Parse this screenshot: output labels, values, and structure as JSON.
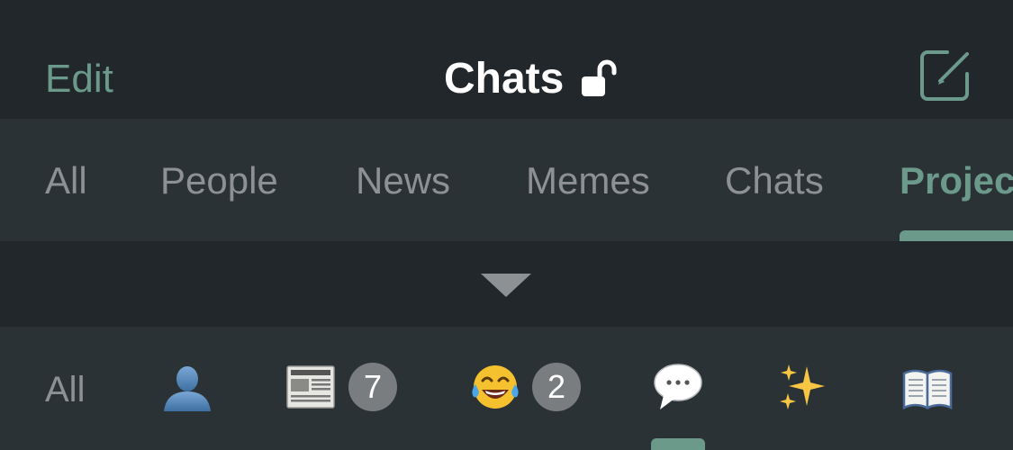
{
  "header": {
    "edit_label": "Edit",
    "title": "Chats",
    "title_icon": "unlocked-padlock-icon",
    "compose_icon": "compose-icon",
    "accent_color": "#6b9a8b"
  },
  "filter_tabs": {
    "items": [
      {
        "label": "All"
      },
      {
        "label": "People"
      },
      {
        "label": "News"
      },
      {
        "label": "Memes"
      },
      {
        "label": "Chats"
      },
      {
        "label": "Projec"
      }
    ],
    "active_index": 5
  },
  "collapse": {
    "icon": "collapse-caret-icon"
  },
  "icon_tabs": {
    "all_label": "All",
    "items": [
      {
        "icon": "person-silhouette-icon",
        "glyph": "👤",
        "badge": ""
      },
      {
        "icon": "newspaper-icon",
        "glyph": "📰",
        "badge": "7"
      },
      {
        "icon": "tears-of-joy-icon",
        "glyph": "😂",
        "badge": "2"
      },
      {
        "icon": "speech-bubble-icon",
        "glyph": "💬",
        "badge": ""
      },
      {
        "icon": "sparkles-icon",
        "glyph": "✨",
        "badge": ""
      },
      {
        "icon": "open-book-icon",
        "glyph": "📖",
        "badge": ""
      }
    ],
    "active_index": 3
  }
}
